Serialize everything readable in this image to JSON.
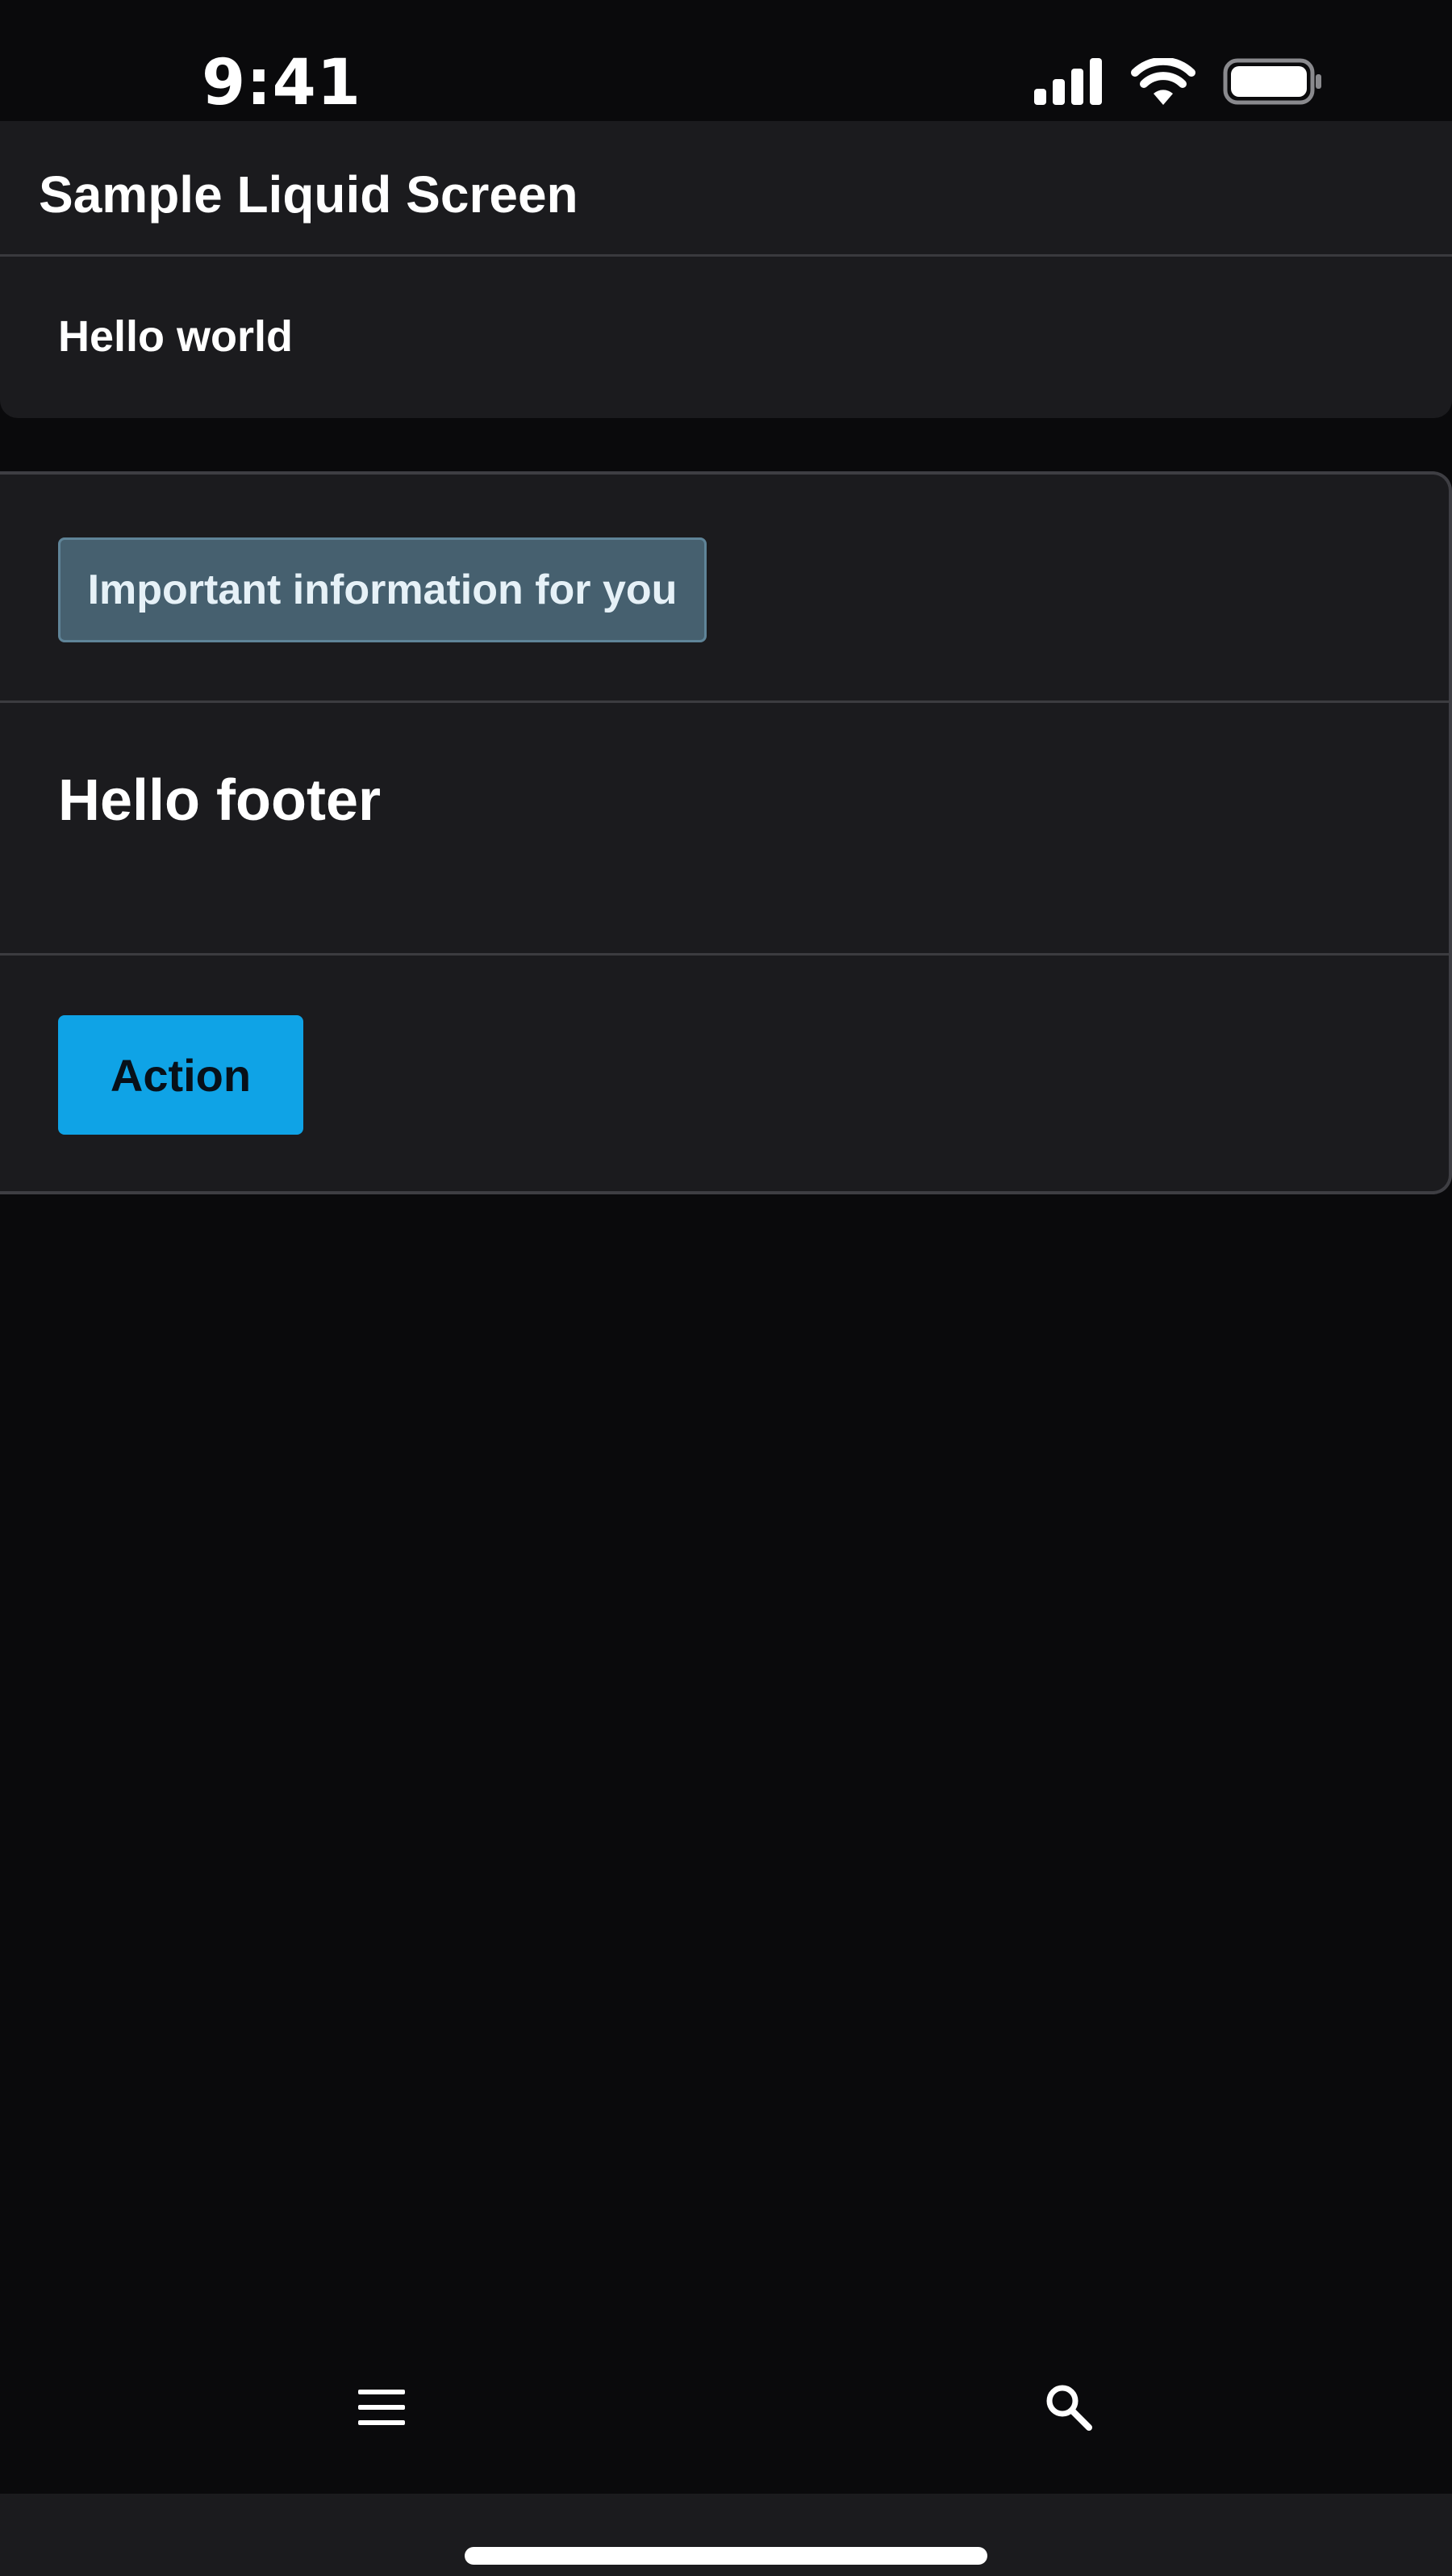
{
  "status_bar": {
    "time": "9:41",
    "icons": [
      "cellular-signal-icon",
      "wifi-icon",
      "battery-icon"
    ]
  },
  "header": {
    "title": "Sample Liquid Screen"
  },
  "greeting_card": {
    "text": "Hello world"
  },
  "panel": {
    "info_badge": "Important information for you",
    "footer_text": "Hello footer",
    "action_label": "Action"
  },
  "bottom_nav": {
    "items": [
      "menu-icon",
      "search-icon"
    ]
  },
  "colors": {
    "background": "#0a0a0c",
    "surface": "#1b1b1e",
    "info_badge_bg": "#46606f",
    "info_badge_border": "#5f8498",
    "accent_button": "#0fa3e6"
  }
}
